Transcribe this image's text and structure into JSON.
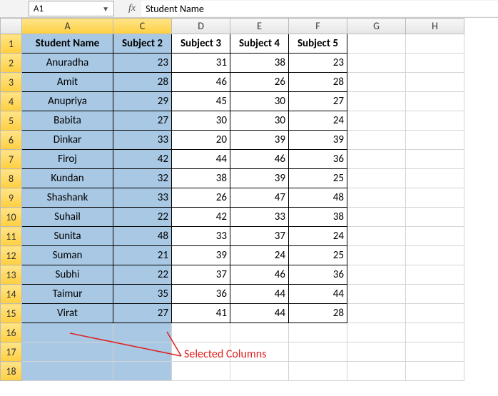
{
  "namebox": {
    "cellref": "A1"
  },
  "formula_bar": {
    "fx_label": "fx",
    "value": "Student Name"
  },
  "column_letters": [
    "A",
    "C",
    "D",
    "E",
    "F",
    "G",
    "H"
  ],
  "selected_col_letters": [
    "A",
    "C"
  ],
  "headers": {
    "a": "Student Name",
    "c": "Subject 2",
    "d": "Subject 3",
    "e": "Subject 4",
    "f": "Subject 5"
  },
  "rows": [
    {
      "n": "2",
      "name": "Anuradha",
      "c": "23",
      "d": "31",
      "e": "38",
      "f": "23"
    },
    {
      "n": "3",
      "name": "Amit",
      "c": "28",
      "d": "46",
      "e": "26",
      "f": "28"
    },
    {
      "n": "4",
      "name": "Anupriya",
      "c": "29",
      "d": "45",
      "e": "30",
      "f": "27"
    },
    {
      "n": "5",
      "name": "Babita",
      "c": "27",
      "d": "30",
      "e": "30",
      "f": "24"
    },
    {
      "n": "6",
      "name": "Dinkar",
      "c": "33",
      "d": "20",
      "e": "39",
      "f": "39"
    },
    {
      "n": "7",
      "name": "Firoj",
      "c": "42",
      "d": "44",
      "e": "46",
      "f": "36"
    },
    {
      "n": "8",
      "name": "Kundan",
      "c": "32",
      "d": "38",
      "e": "39",
      "f": "25"
    },
    {
      "n": "9",
      "name": "Shashank",
      "c": "33",
      "d": "26",
      "e": "47",
      "f": "48"
    },
    {
      "n": "10",
      "name": "Suhail",
      "c": "22",
      "d": "42",
      "e": "33",
      "f": "38"
    },
    {
      "n": "11",
      "name": "Sunita",
      "c": "48",
      "d": "33",
      "e": "37",
      "f": "24"
    },
    {
      "n": "12",
      "name": "Suman",
      "c": "21",
      "d": "39",
      "e": "24",
      "f": "25"
    },
    {
      "n": "13",
      "name": "Subhi",
      "c": "22",
      "d": "37",
      "e": "46",
      "f": "36"
    },
    {
      "n": "14",
      "name": "Taimur",
      "c": "35",
      "d": "36",
      "e": "44",
      "f": "44"
    },
    {
      "n": "15",
      "name": "Virat",
      "c": "27",
      "d": "41",
      "e": "44",
      "f": "28"
    }
  ],
  "empty_rows": [
    "16",
    "17",
    "18"
  ],
  "row_label_1": "1",
  "annotation": {
    "text": "Selected Columns"
  }
}
